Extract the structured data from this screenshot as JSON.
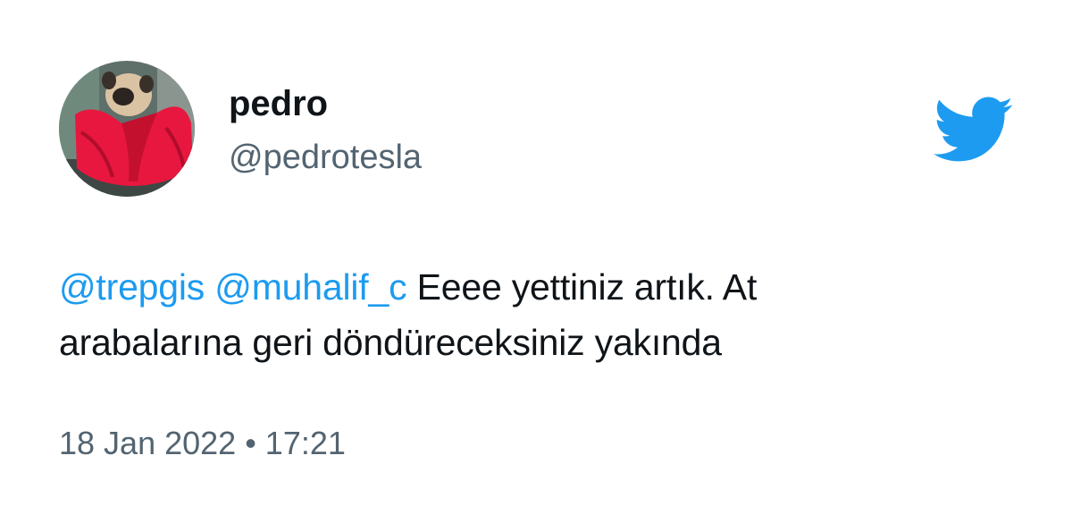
{
  "tweet": {
    "author": {
      "display_name": "pedro",
      "handle": "@pedrotesla",
      "avatar_icon": "avatar-pug-in-red-blanket"
    },
    "platform_icon": "twitter-bird-icon",
    "body": {
      "mentions": [
        "@trepgis",
        "@muhalif_c"
      ],
      "line1_text": "Eeee yettiniz artık. At",
      "line2_text": "arabalarına geri döndüreceksiniz yakında"
    },
    "date": "18 Jan 2022",
    "separator": "•",
    "time": "17:21"
  },
  "colors": {
    "text_primary": "#0f1419",
    "text_secondary": "#536471",
    "link": "#1d9bf0",
    "twitter_blue": "#1d9bf0",
    "blanket_red": "#e8173f"
  }
}
